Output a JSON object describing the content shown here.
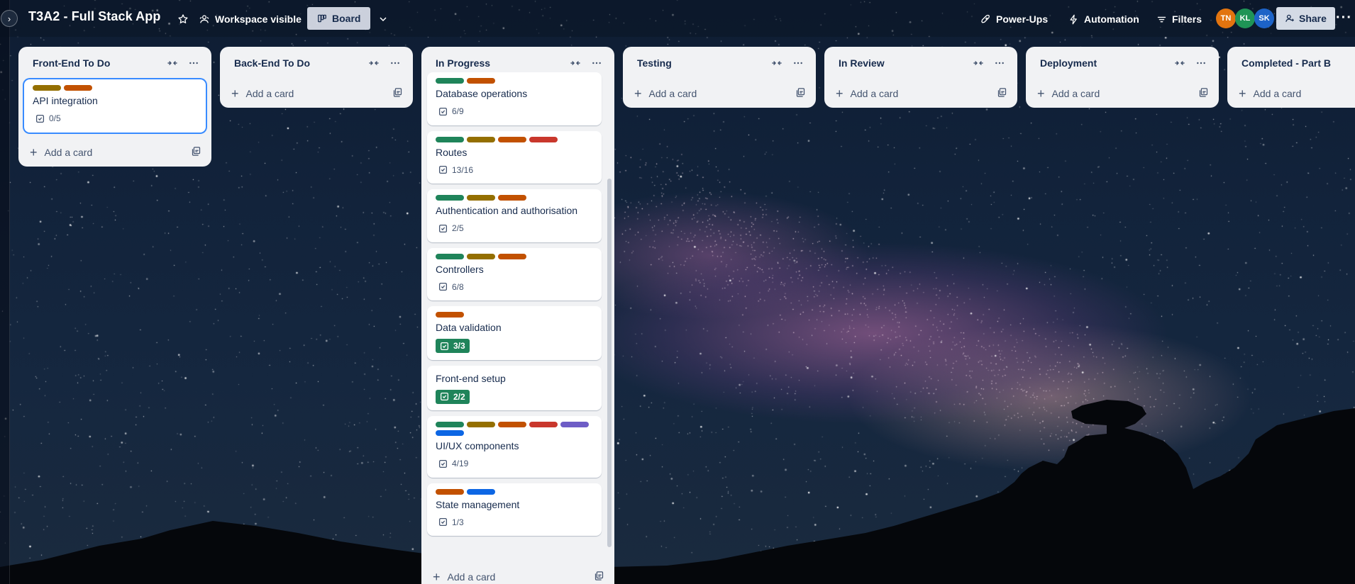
{
  "board": {
    "title": "T3A2 - Full Stack App",
    "visibility": "Workspace visible",
    "view": "Board"
  },
  "toolbar": {
    "powerups": "Power-Ups",
    "automation": "Automation",
    "filters": "Filters",
    "share": "Share"
  },
  "members": [
    {
      "initials": "TN",
      "color": "#e2740f"
    },
    {
      "initials": "KL",
      "color": "#1f9456"
    },
    {
      "initials": "SK",
      "color": "#1d63c7"
    }
  ],
  "label_colors": {
    "green": "#1f845a",
    "yellow": "#946f00",
    "orange": "#c25100",
    "red": "#c9372c",
    "purple": "#6e5dc6",
    "blue": "#0c66e4"
  },
  "add_card_label": "Add a card",
  "lists": [
    {
      "title": "Front-End To Do",
      "cards": [
        {
          "title": "API integration",
          "labels": [
            "yellow",
            "orange"
          ],
          "checklist": "0/5",
          "complete": false,
          "selected": true
        }
      ]
    },
    {
      "title": "Back-End To Do",
      "cards": []
    },
    {
      "title": "In Progress",
      "cards": [
        {
          "title": "Database operations",
          "labels": [
            "green",
            "orange"
          ],
          "checklist": "6/9",
          "complete": false
        },
        {
          "title": "Routes",
          "labels": [
            "green",
            "yellow",
            "orange",
            "red"
          ],
          "checklist": "13/16",
          "complete": false
        },
        {
          "title": "Authentication and authorisation",
          "labels": [
            "green",
            "yellow",
            "orange"
          ],
          "checklist": "2/5",
          "complete": false
        },
        {
          "title": "Controllers",
          "labels": [
            "green",
            "yellow",
            "orange"
          ],
          "checklist": "6/8",
          "complete": false
        },
        {
          "title": "Data validation",
          "labels": [
            "orange"
          ],
          "checklist": "3/3",
          "complete": true
        },
        {
          "title": "Front-end setup",
          "labels": [],
          "checklist": "2/2",
          "complete": true
        },
        {
          "title": "UI/UX components",
          "labels": [
            "green",
            "yellow",
            "orange",
            "red",
            "purple",
            "blue"
          ],
          "checklist": "4/19",
          "complete": false
        },
        {
          "title": "State management",
          "labels": [
            "orange",
            "blue"
          ],
          "checklist": "1/3",
          "complete": false
        }
      ]
    },
    {
      "title": "Testing",
      "cards": []
    },
    {
      "title": "In Review",
      "cards": []
    },
    {
      "title": "Deployment",
      "cards": []
    },
    {
      "title": "Completed - Part B",
      "cards": []
    }
  ]
}
